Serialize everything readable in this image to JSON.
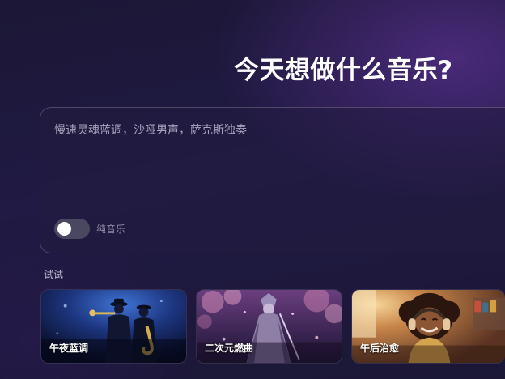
{
  "header": {
    "title": "今天想做什么音乐?"
  },
  "prompt": {
    "placeholder": "慢速灵魂蓝调，沙哑男声，萨克斯独奏",
    "value": ""
  },
  "instrumental_toggle": {
    "label": "纯音乐",
    "on": false
  },
  "suggestions": {
    "label": "试试",
    "cards": [
      {
        "label": "午夜蓝调",
        "image": "jazz-musicians-image"
      },
      {
        "label": "二次元燃曲",
        "image": "anime-cherry-blossom-image"
      },
      {
        "label": "午后治愈",
        "image": "girl-with-headphones-image"
      }
    ]
  },
  "colors": {
    "background": "#1e1a3c",
    "accent_glow": "#6c38a8",
    "toggle_off": "#4a4760"
  }
}
